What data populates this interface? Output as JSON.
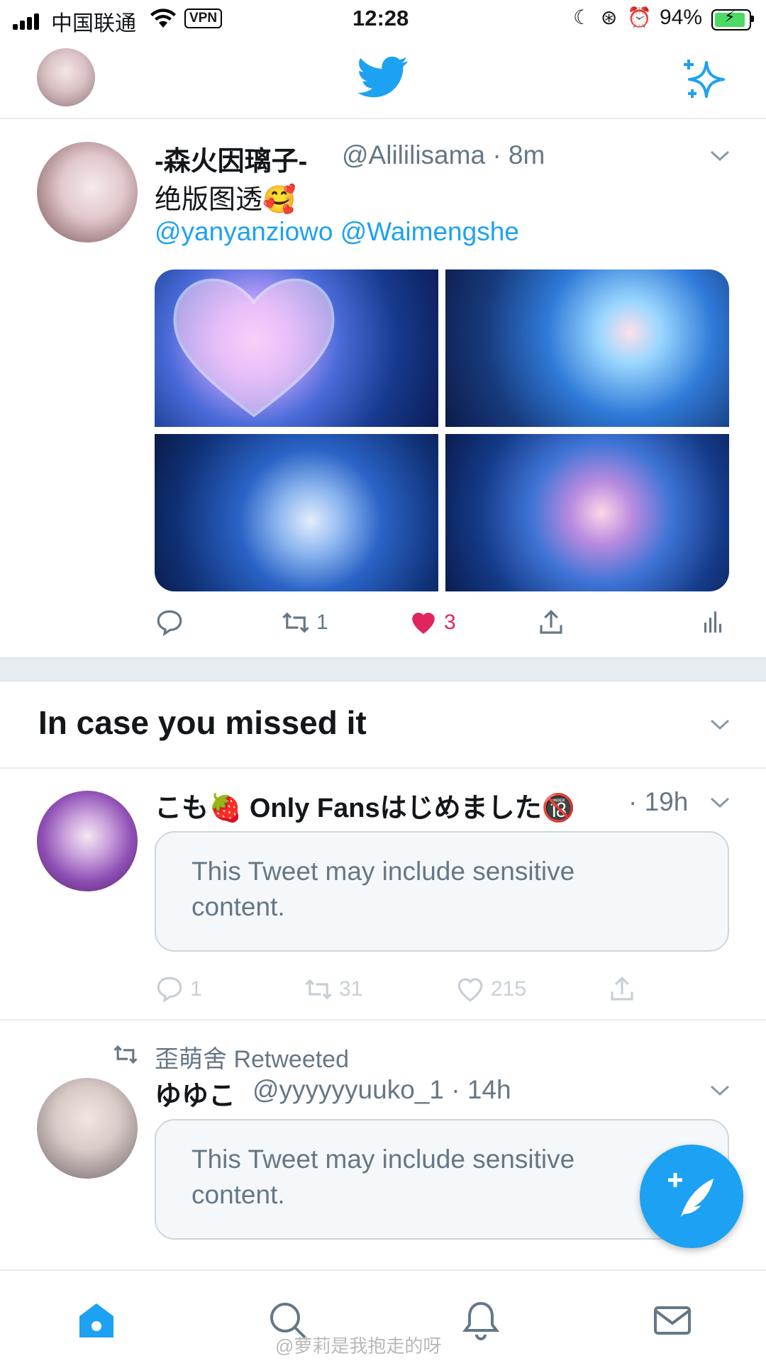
{
  "status_bar": {
    "carrier": "中国联通",
    "vpn": "VPN",
    "time": "12:28",
    "battery": "94%"
  },
  "colors": {
    "accent": "#1da1f2",
    "like": "#e0245e",
    "muted": "#657786"
  },
  "header": {
    "logo": "twitter-bird-icon",
    "sparkle": "sparkle-icon"
  },
  "tweet1": {
    "name": "-森火因璃子-",
    "handle": "@Alililisama · 8m",
    "text": "绝版图透🥰",
    "mentions": "@yanyanziowo @Waimengshe",
    "retweets": "1",
    "likes": "3"
  },
  "section": {
    "title": "In case you missed it"
  },
  "tweet2": {
    "name": "こも🍓 Only Fansはじめました🔞",
    "time": "· 19h",
    "sensitive": "This Tweet may include sensitive content.",
    "replies": "1",
    "retweets": "31",
    "likes": "215"
  },
  "tweet3": {
    "retweeted_by": "歪萌舍 Retweeted",
    "name": "ゆゆこ",
    "handle": "@yyyyyyuuko_1 · 14h",
    "sensitive": "This Tweet may include sensitive content."
  },
  "tabbar": {
    "items": [
      "home-icon",
      "search-icon",
      "bell-icon",
      "mail-icon"
    ]
  },
  "watermark": "@萝莉是我抱走的呀"
}
